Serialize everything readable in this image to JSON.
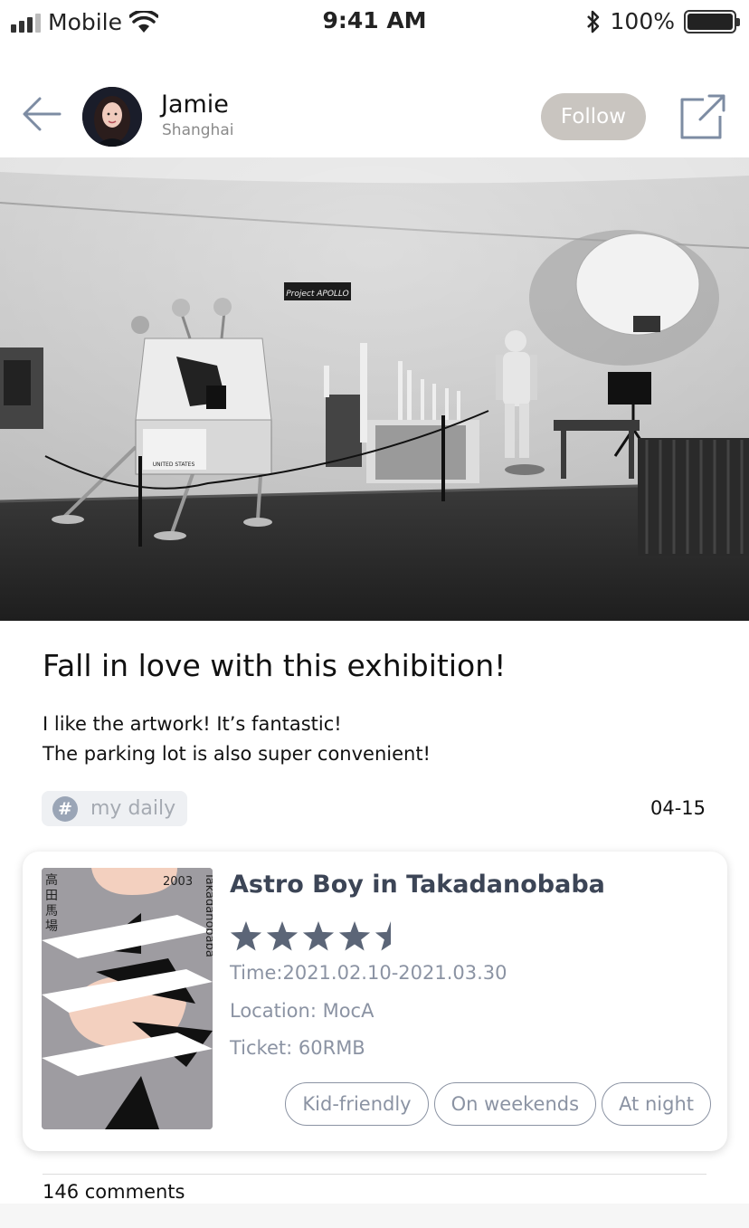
{
  "status_bar": {
    "carrier": "Mobile",
    "time": "9:41 AM",
    "battery_text": "100%",
    "battery_level": 1.0
  },
  "header": {
    "user_name": "Jamie",
    "user_location": "Shanghai",
    "follow_label": "Follow",
    "back_icon": "arrow-left-icon",
    "share_icon": "share-external-icon"
  },
  "post": {
    "title": "Fall in love with this exhibition!",
    "body_line1": "I like the artwork! It’s fantastic!",
    "body_line2": "The parking lot is also super convenient!",
    "tag_symbol": "#",
    "tag_label": "my daily",
    "date": "04-15"
  },
  "hero_image": {
    "sign_text": "Project APOLLO",
    "lander_text": "UNITED STATES"
  },
  "exhibition_card": {
    "title": "Astro Boy in Takadanobaba",
    "rating": 4.5,
    "rating_max": 5,
    "time": "Time:2021.02.10-2021.03.30",
    "location": "Location: MocA",
    "ticket": "Ticket: 60RMB",
    "chips": [
      "Kid-friendly",
      "On weekends",
      "At night"
    ],
    "poster": {
      "year": "2003",
      "vertical_text": "Takadanobaba",
      "kanji": "高田馬場"
    }
  },
  "footer": {
    "comments": "146 comments"
  },
  "colors": {
    "follow_bg": "#c9c5c0",
    "card_title": "#3c4556",
    "meta_text": "#8b93a3",
    "star": "#5b6577",
    "tag_bg": "#eef0f3"
  }
}
